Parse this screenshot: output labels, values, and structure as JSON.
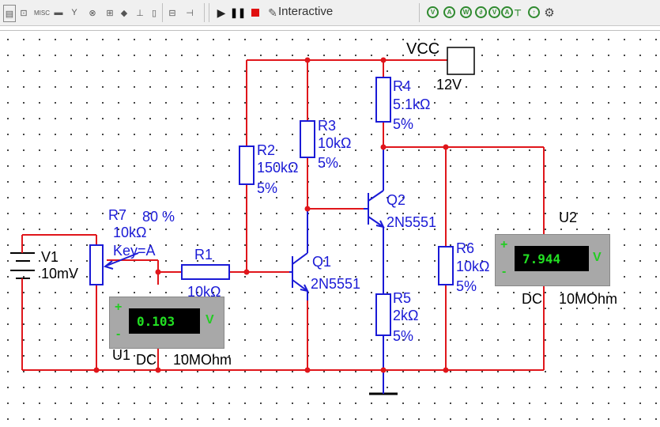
{
  "toolbar": {
    "mode_label": "Interactive",
    "misc_label": "MISC"
  },
  "power": {
    "vcc_label": "VCC",
    "vcc_value": "12V"
  },
  "components": {
    "r4": {
      "name": "R4",
      "value": "5.1kΩ",
      "tol": "5%"
    },
    "r3": {
      "name": "R3",
      "value": "10kΩ",
      "tol": "5%"
    },
    "r2": {
      "name": "R2",
      "value": "150kΩ",
      "tol": "5%"
    },
    "r7": {
      "name": "R7",
      "percent": "80 %",
      "value": "10kΩ",
      "key": "Key=A"
    },
    "r1": {
      "name": "R1",
      "value": "10kΩ"
    },
    "r5": {
      "name": "R5",
      "value": "2kΩ",
      "tol": "5%"
    },
    "r6": {
      "name": "R6",
      "value": "10kΩ",
      "tol": "5%"
    },
    "q1": {
      "name": "Q1",
      "model": "2N5551"
    },
    "q2": {
      "name": "Q2",
      "model": "2N5551"
    },
    "v1": {
      "name": "V1",
      "value": "10mV"
    }
  },
  "meters": {
    "u1": {
      "name": "U1",
      "reading": "0.103",
      "unit": "V",
      "plus": "+",
      "minus": "-",
      "mode": "DC",
      "impedance": "10MOhm"
    },
    "u2": {
      "name": "U2",
      "reading": "7.944",
      "unit": "V",
      "plus": "+",
      "minus": "-",
      "mode": "DC",
      "impedance": "10MOhm"
    }
  },
  "colors": {
    "wire": "#e0161b",
    "component": "#1a1ad6",
    "junction": "#e0161b"
  }
}
